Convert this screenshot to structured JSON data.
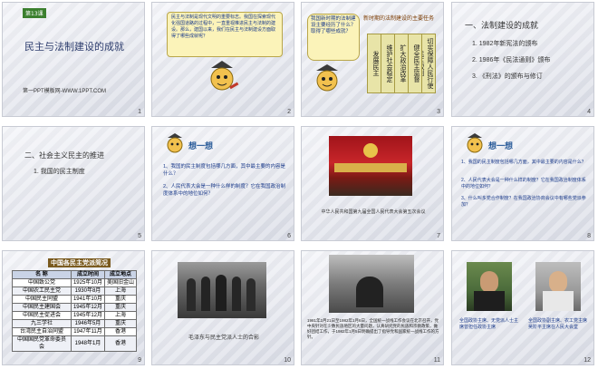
{
  "slides": [
    {
      "num": "1",
      "badge": "第13课",
      "title": "民主与法制建设的成就",
      "footer": "第一PPT模板网-WWW.1PPT.COM"
    },
    {
      "num": "2",
      "text": "民主与法制是现代文明的重要标志。我国在探索现代化强国道路的过程中，一直重视推进民主与法制的建设。那么，建国以来，我们在民主与法制建设方面取得了哪些成就呢？"
    },
    {
      "num": "3",
      "q": "我国新时期的法制建设主要经历了什么？取得了哪些成就？",
      "header": "新时期的法制建设的主要任务",
      "cols": [
        "切实保障人民行使民主权利",
        "健全民主监督",
        "扩大政治改革",
        "维护社会稳定",
        "发展民主"
      ]
    },
    {
      "num": "4",
      "heading": "一、法制建设的成就",
      "items": [
        "1. 1982年新宪法的颁布",
        "2. 1986年《民法通则》颁布",
        "3. 《刑法》的颁布与修订"
      ]
    },
    {
      "num": "5",
      "heading": "二、社会主义民主的推进",
      "items": [
        "1. 我国的民主制度"
      ]
    },
    {
      "num": "6",
      "title": "想一想",
      "text1": "1、我国的民主制度包括哪几方面，其中最主要的内容是什么？",
      "text2": "2、人民代表大会是一种什么样的制度？它在我国政治制度体系中的地位如何？"
    },
    {
      "num": "7",
      "caption": "中华人民共和国第九届全国人民代表大会第五次会议"
    },
    {
      "num": "8",
      "title": "想一想",
      "text1": "1、我国的民主制度包括哪几方面，其中最主要的内容是什么？",
      "text2": "2、人民代表大会是一种什么样的制度？它在我国政治制度体系中的地位如何？",
      "text3": "3、什么叫多党合作制度？在我国政治协商会议中有哪些党派参加？"
    },
    {
      "num": "9",
      "table_title": "中国各民主党派简况",
      "headers": [
        "名 称",
        "成立时间",
        "成立地点"
      ],
      "rows": [
        [
          "中国致公党",
          "1925年10月",
          "美国旧金山"
        ],
        [
          "中国农工民主党",
          "1930年8月",
          "上海"
        ],
        [
          "中国民主同盟",
          "1941年10月",
          "重庆"
        ],
        [
          "中国民主建国会",
          "1945年12月",
          "重庆"
        ],
        [
          "中国民主促进会",
          "1945年12月",
          "上海"
        ],
        [
          "九三学社",
          "1946年5月",
          "重庆"
        ],
        [
          "台湾民主自治同盟",
          "1947年11月",
          "香港"
        ],
        [
          "中国国民党革命委员会",
          "1948年1月",
          "香港"
        ]
      ]
    },
    {
      "num": "10",
      "caption": "毛泽东与民主党派人士的合影"
    },
    {
      "num": "11",
      "text": "1981年2月21日至1982年1月6日，全国统一战线工作会议在北京召开，党中央针对在少数民族地区的大量问题，认真研究党的民族和宗教政策，做好团结工作，于1982年1月5日明确提出了指导党和国家统一战线工作的方针。"
    },
    {
      "num": "12",
      "caption1": "全国政协主席、无党派人士主席曾担任政协主席",
      "caption2": "全国政协副主席、农工党主席吴阶平主席在人民大会堂"
    }
  ],
  "colors": {
    "accent_red": "#c0392b",
    "banner_brown": "#7a5a1e",
    "badge_green": "#3b7f2e"
  }
}
